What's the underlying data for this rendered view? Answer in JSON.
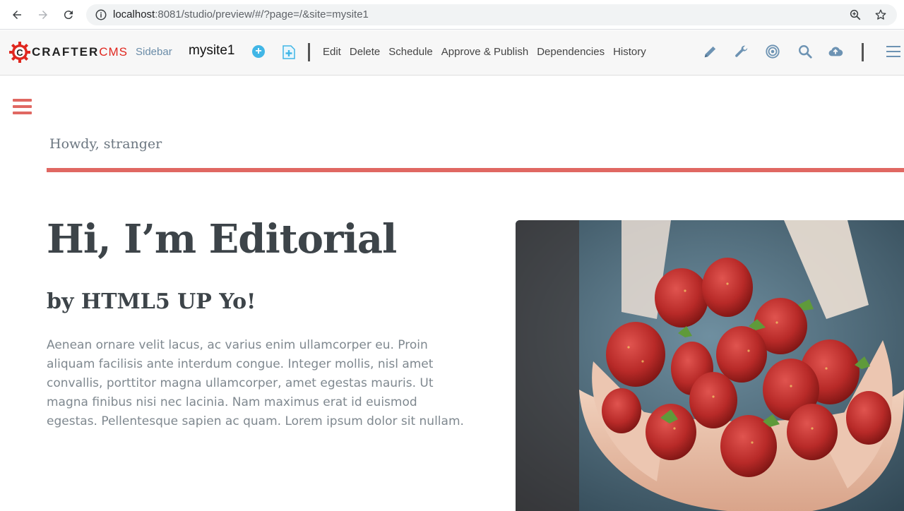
{
  "browser": {
    "url_host": "localhost",
    "url_rest": ":8081/studio/preview/#/?page=/&site=mysite1"
  },
  "studio": {
    "logo_crafter": "CRAFTER",
    "logo_cms": "CMS",
    "sidebar_label": "Sidebar",
    "site_name": "mysite1",
    "actions": [
      "Edit",
      "Delete",
      "Schedule",
      "Approve & Publish",
      "Dependencies",
      "History"
    ],
    "icons": [
      "pencil-icon",
      "wrench-icon",
      "target-icon",
      "search-icon",
      "cloud-upload-icon",
      "menu-icon"
    ],
    "accent_color": "#6d93b3"
  },
  "page": {
    "greeting": "Howdy, stranger",
    "title": "Hi, I’m Editorial",
    "subtitle": "by HTML5 UP Yo!",
    "body": "Aenean ornare velit lacus, ac varius enim ullamcorper eu. Proin aliquam facilisis ante interdum congue. Integer mollis, nisl amet convallis, porttitor magna ullamcorper, amet egestas mauris. Ut magna finibus nisi nec lacinia. Nam maximus erat id euismod egestas. Pellentesque sapien ac quam. Lorem ipsum dolor sit nullam.",
    "accent_color": "#e06862",
    "image": "strawberries-in-hands"
  }
}
